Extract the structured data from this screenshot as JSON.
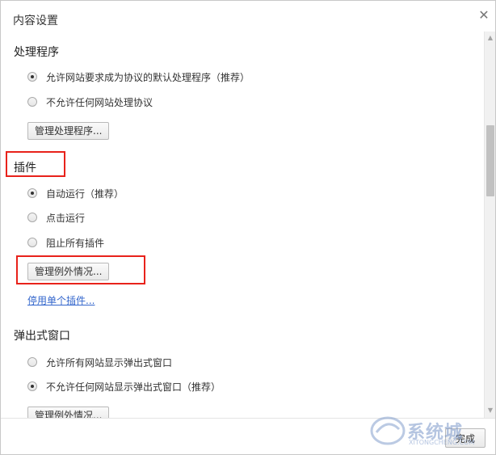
{
  "dialog": {
    "title": "内容设置",
    "close_glyph": "✕"
  },
  "handlers": {
    "title": "处理程序",
    "options": [
      {
        "label": "允许网站要求成为协议的默认处理程序（推荐）",
        "checked": true
      },
      {
        "label": "不允许任何网站处理协议",
        "checked": false
      }
    ],
    "manage_button": "管理处理程序..."
  },
  "plugins": {
    "title": "插件",
    "options": [
      {
        "label": "自动运行（推荐）",
        "checked": true
      },
      {
        "label": "点击运行",
        "checked": false
      },
      {
        "label": "阻止所有插件",
        "checked": false
      }
    ],
    "manage_button": "管理例外情况...",
    "disable_link": "停用单个插件..."
  },
  "popups": {
    "title": "弹出式窗口",
    "options": [
      {
        "label": "允许所有网站显示弹出式窗口",
        "checked": false
      },
      {
        "label": "不允许任何网站显示弹出式窗口（推荐）",
        "checked": true
      }
    ],
    "manage_button": "管理例外情况..."
  },
  "footer": {
    "done_button": "完成"
  },
  "watermark": {
    "text": "系统城",
    "sub": "XITONGCHENG.COM"
  },
  "colors": {
    "highlight": "#e8221b",
    "link": "#3366cc"
  }
}
